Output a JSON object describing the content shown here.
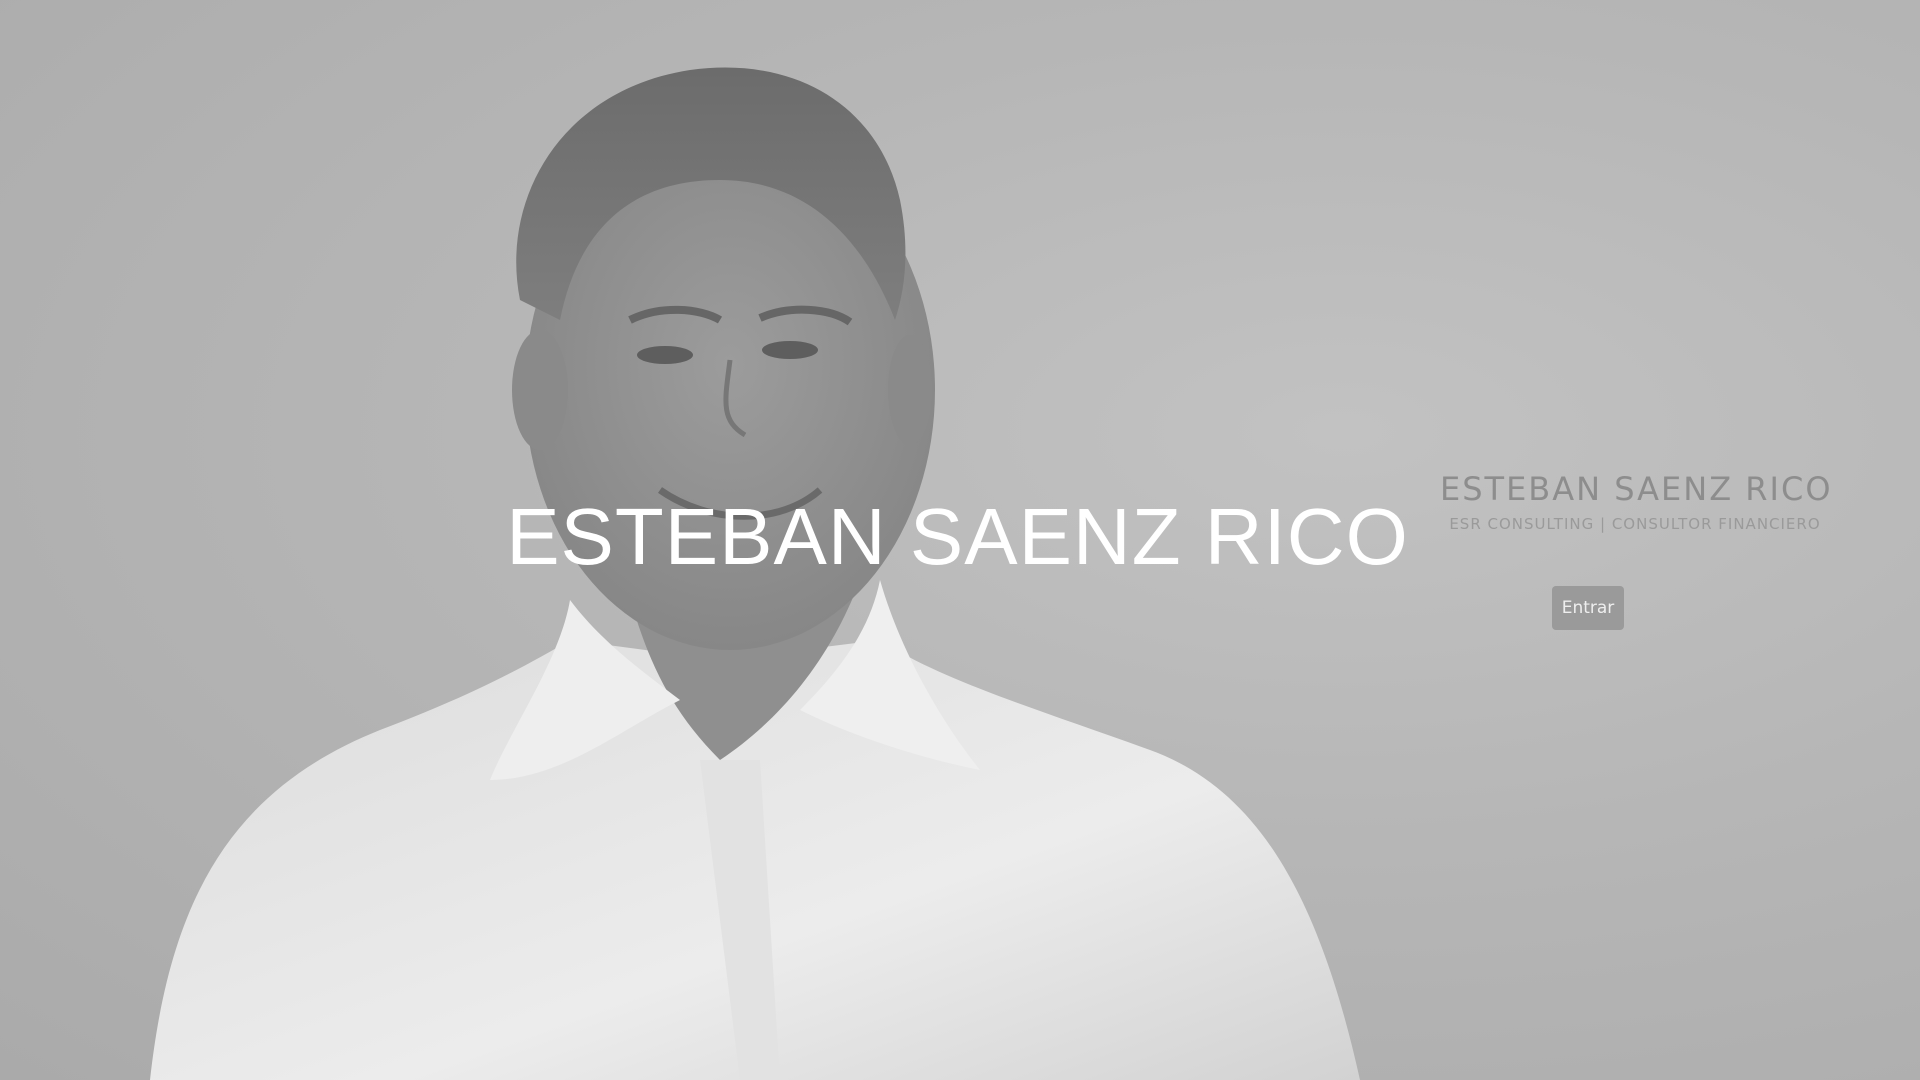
{
  "hero": {
    "title": "ESTEBAN SAENZ RICO"
  },
  "brand": {
    "name": "ESTEBAN SAENZ RICO",
    "tagline": "ESR CONSULTING | CONSULTOR FINANCIERO"
  },
  "actions": {
    "enter_label": "Entrar"
  },
  "colors": {
    "background": "#b4b4b4",
    "title": "#ffffff",
    "brand_text": "#8d8d8d",
    "button_bg": "#9a9a9a",
    "button_text": "#eeeeee"
  }
}
